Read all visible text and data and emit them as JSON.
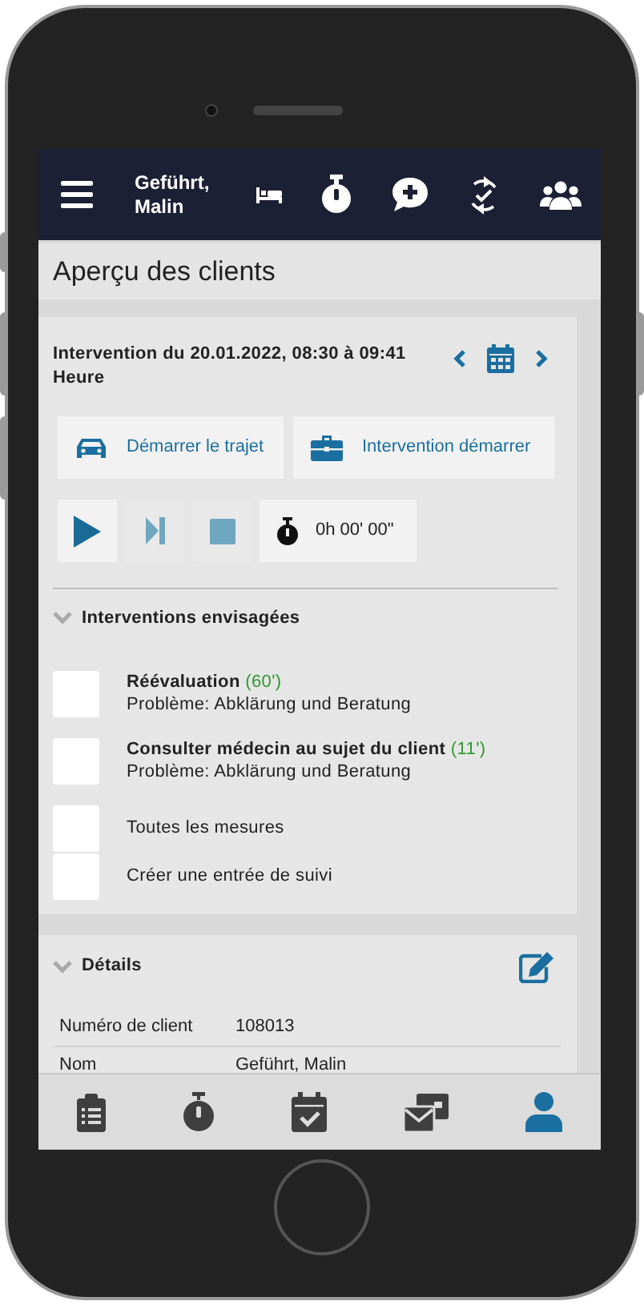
{
  "header": {
    "user_name": "Geführt, Malin"
  },
  "page_title": "Aperçu des clients",
  "intervention": {
    "date_text": "Intervention du 20.01.2022, 08:30 à 09:41 Heure",
    "actions": [
      {
        "kind": "car",
        "label": "Démarrer le trajet"
      },
      {
        "kind": "briefcase",
        "label": "Intervention démarrer"
      }
    ],
    "controls": [
      {
        "kind": "play",
        "disabled": false
      },
      {
        "kind": "next",
        "disabled": true
      },
      {
        "kind": "stop",
        "disabled": true
      }
    ],
    "timer": "0h 00' 00\""
  },
  "planned": {
    "title": "Interventions envisagées",
    "expanded": true,
    "items": [
      {
        "kind": "measure",
        "title": "Réévaluation",
        "duration": "(60')",
        "problem": "Problème: Abklärung und Beratung",
        "checked": false
      },
      {
        "kind": "measure",
        "title": "Consulter médecin au sujet du client",
        "duration": "(11')",
        "problem": "Problème: Abklärung und Beratung",
        "checked": false
      },
      {
        "kind": "plain",
        "title": "Toutes les mesures",
        "checked": false
      },
      {
        "kind": "plain",
        "title": "Créer une entrée de suivi",
        "checked": false
      }
    ]
  },
  "details": {
    "title": "Détails",
    "expanded": true,
    "rows": [
      {
        "label": "Numéro de client",
        "value": "108013"
      },
      {
        "label": "Nom",
        "value": "Geführt, Malin"
      }
    ]
  },
  "bottom_nav": [
    {
      "kind": "clipboard",
      "selected": false
    },
    {
      "kind": "stopwatch",
      "selected": false
    },
    {
      "kind": "calendar",
      "selected": false
    },
    {
      "kind": "messages",
      "selected": false
    },
    {
      "kind": "person",
      "selected": true
    }
  ]
}
